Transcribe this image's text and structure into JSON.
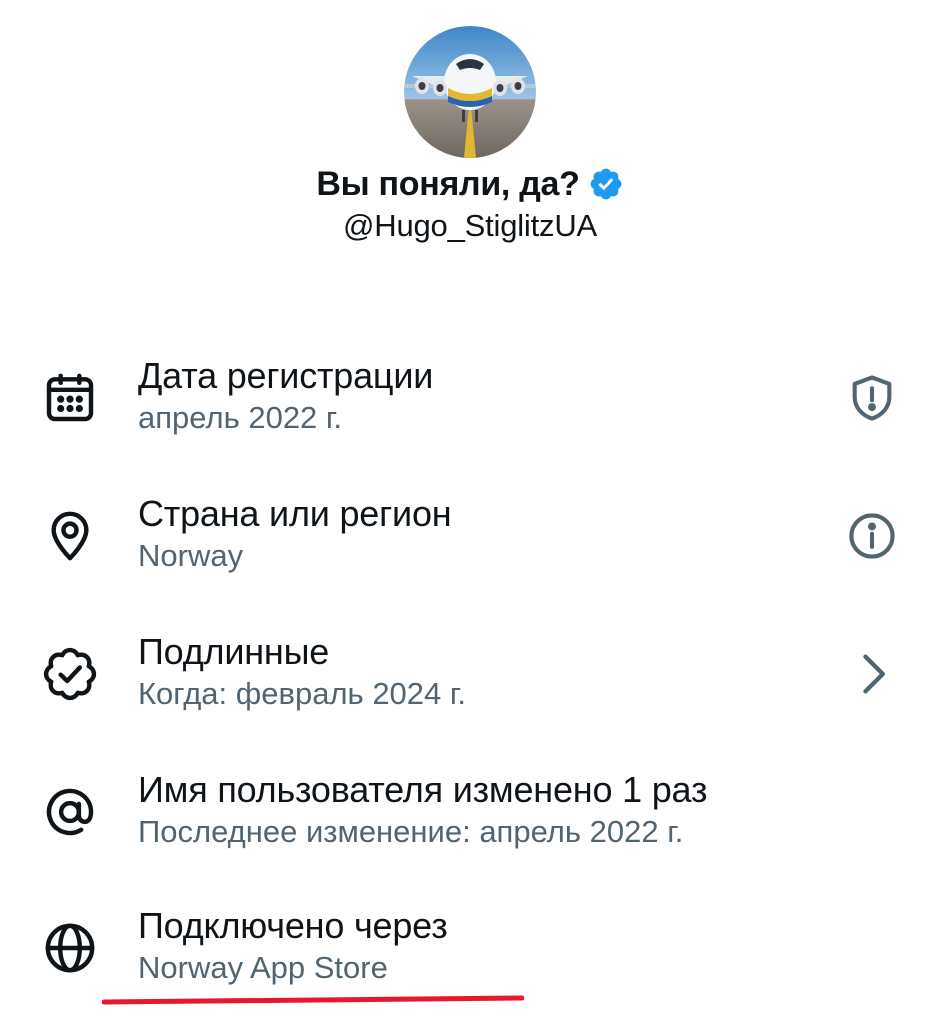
{
  "profile": {
    "display_name": "Вы поняли, да?",
    "handle": "@Hugo_StiglitzUA",
    "verified": true
  },
  "rows": [
    {
      "icon": "calendar-icon",
      "title": "Дата регистрации",
      "subtitle": "апрель 2022 г.",
      "right_icon": "shield-alert-icon"
    },
    {
      "icon": "location-pin-icon",
      "title": "Страна или регион",
      "subtitle": "Norway",
      "right_icon": "info-icon"
    },
    {
      "icon": "verified-check-icon",
      "title": "Подлинные",
      "subtitle": "Когда: февраль 2024 г.",
      "right_icon": "chevron-right-icon"
    },
    {
      "icon": "at-sign-icon",
      "title": "Имя пользователя изменено 1 раз",
      "subtitle": "Последнее изменение: апрель 2022 г.",
      "right_icon": null
    },
    {
      "icon": "globe-icon",
      "title": "Подключено через",
      "subtitle": "Norway App Store",
      "right_icon": null
    }
  ],
  "colors": {
    "text_primary": "#0f1419",
    "text_secondary": "#536471",
    "verified_blue": "#1d9bf0",
    "highlight_red": "#e8172a"
  }
}
